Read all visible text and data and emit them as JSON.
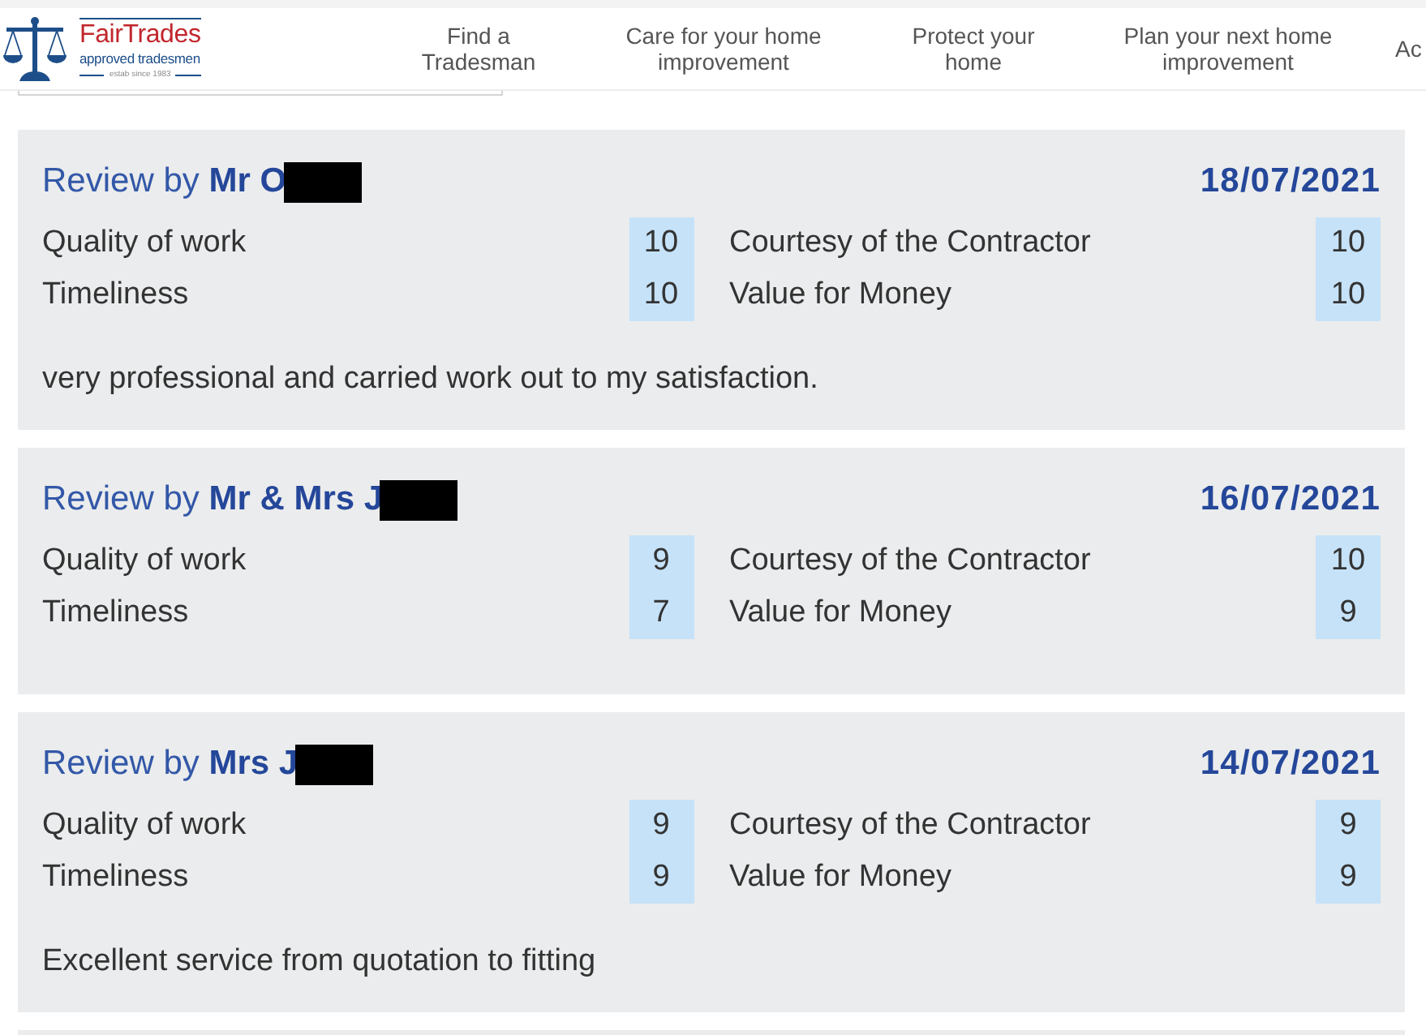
{
  "header": {
    "logo": {
      "name": "FairTrades",
      "tagline": "approved tradesmen",
      "established": "estab since 1983"
    },
    "nav": [
      {
        "lines": [
          "Find a",
          "Tradesman"
        ]
      },
      {
        "lines": [
          "Care for your home",
          "improvement"
        ]
      },
      {
        "lines": [
          "Protect your",
          "home"
        ]
      },
      {
        "lines": [
          "Plan your next home",
          "improvement"
        ]
      },
      {
        "lines": [
          "Ac"
        ]
      }
    ]
  },
  "reviews": [
    {
      "title": "Review by **Mr O**",
      "redacted": true,
      "date": "18/07/2021",
      "scores": [
        {
          "label": "Quality of work",
          "value": "10"
        },
        {
          "label": "Courtesy of the Contractor",
          "value": "10"
        },
        {
          "label": "Timeliness",
          "value": "10"
        },
        {
          "label": "Value for Money",
          "value": "10"
        }
      ],
      "comment": "very professional and carried work out to my satisfaction."
    },
    {
      "title": "Review by **Mr & Mrs J**",
      "redacted": true,
      "date": "16/07/2021",
      "scores": [
        {
          "label": "Quality of work",
          "value": "9"
        },
        {
          "label": "Courtesy of the Contractor",
          "value": "10"
        },
        {
          "label": "Timeliness",
          "value": "7"
        },
        {
          "label": "Value for Money",
          "value": "9"
        }
      ]
    },
    {
      "title": "Review by **Mrs J**",
      "redacted": true,
      "date": "14/07/2021",
      "scores": [
        {
          "label": "Quality of work",
          "value": "9"
        },
        {
          "label": "Courtesy of the Contractor",
          "value": "9"
        },
        {
          "label": "Timeliness",
          "value": "9"
        },
        {
          "label": "Value for Money",
          "value": "9"
        }
      ],
      "comment": "Excellent service from quotation to fitting"
    }
  ]
}
